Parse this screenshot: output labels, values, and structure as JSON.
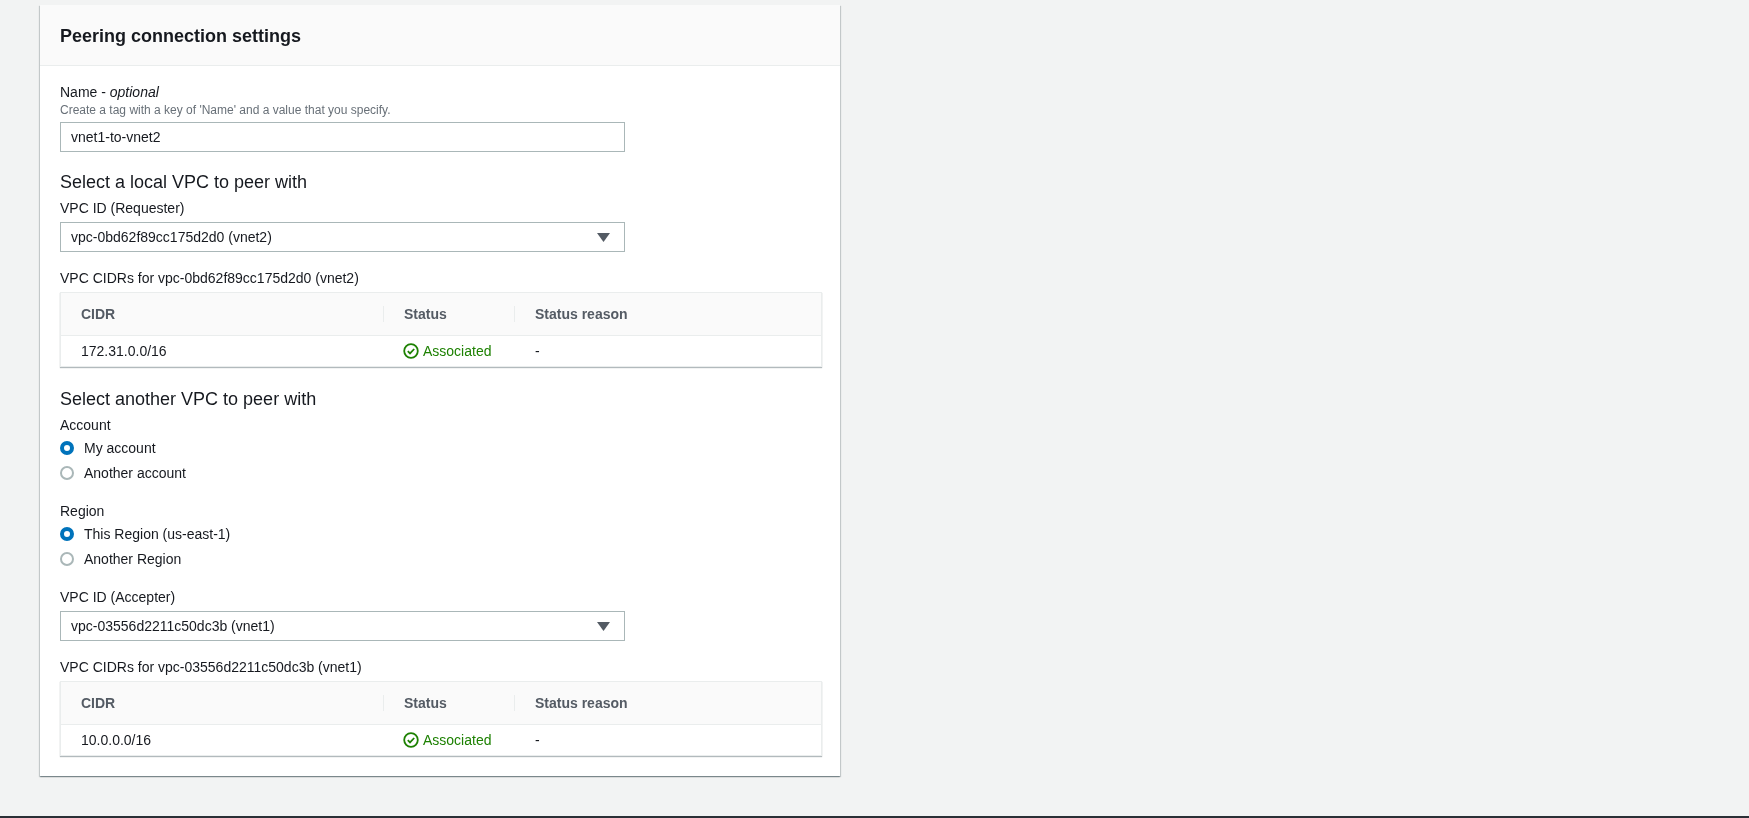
{
  "panel": {
    "title": "Peering connection settings"
  },
  "name_field": {
    "label": "Name - *optional*",
    "hint": "Create a tag with a key of 'Name' and a value that you specify.",
    "value": "vnet1-to-vnet2"
  },
  "local_vpc": {
    "heading": "Select a local VPC to peer with",
    "select_label": "VPC ID (Requester)",
    "select_value": "vpc-0bd62f89cc175d2d0 (vnet2)",
    "cidrs_label": "VPC CIDRs for vpc-0bd62f89cc175d2d0 (vnet2)",
    "table": {
      "columns": [
        "CIDR",
        "Status",
        "Status reason"
      ],
      "rows": [
        {
          "cidr": "172.31.0.0/16",
          "status": {
            "text": "Associated",
            "kind": "success"
          },
          "reason": "-"
        }
      ]
    }
  },
  "peer_vpc": {
    "heading": "Select another VPC to peer with",
    "radio_groups": [
      {
        "label": "Account",
        "options": [
          {
            "label": "My account",
            "selected": true
          },
          {
            "label": "Another account",
            "selected": false
          }
        ]
      },
      {
        "label": "Region",
        "options": [
          {
            "label": "This Region (us-east-1)",
            "selected": true
          },
          {
            "label": "Another Region",
            "selected": false
          }
        ]
      }
    ],
    "select_label": "VPC ID (Accepter)",
    "select_value": "vpc-03556d2211c50dc3b (vnet1)",
    "cidrs_label": "VPC CIDRs for vpc-03556d2211c50dc3b (vnet1)",
    "table": {
      "columns": [
        "CIDR",
        "Status",
        "Status reason"
      ],
      "rows": [
        {
          "cidr": "10.0.0.0/16",
          "status": {
            "text": "Associated",
            "kind": "success"
          },
          "reason": "-"
        }
      ]
    }
  }
}
